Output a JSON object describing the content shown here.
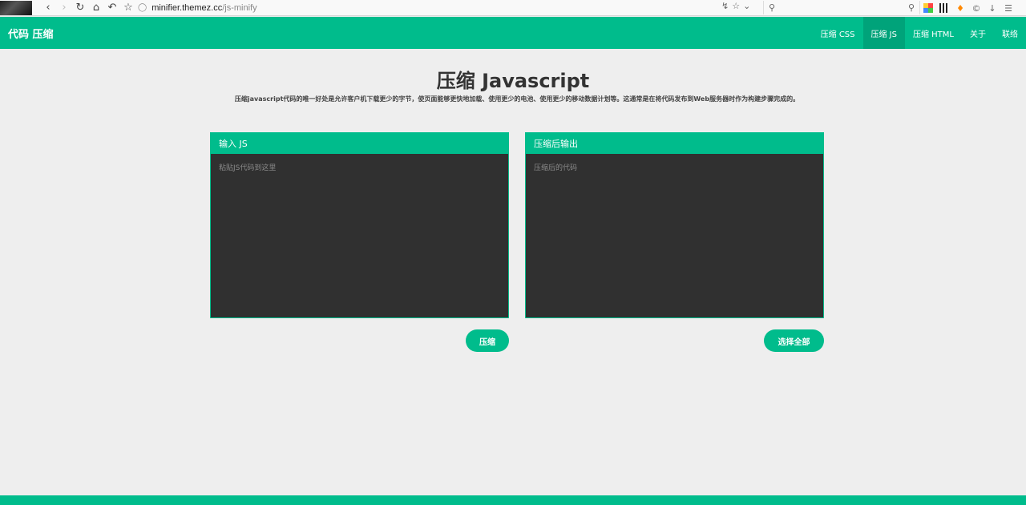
{
  "browser": {
    "url_host": "minifier.themez.cc",
    "url_path": "/js-minify"
  },
  "navbar": {
    "brand": "代码 压缩",
    "links": [
      {
        "label": "压缩 CSS",
        "active": false
      },
      {
        "label": "压缩 JS",
        "active": true
      },
      {
        "label": "压缩 HTML",
        "active": false
      },
      {
        "label": "关于",
        "active": false
      },
      {
        "label": "联络",
        "active": false
      }
    ]
  },
  "main": {
    "title_bold": "压缩",
    "title_rest": " Javascript",
    "description": "压缩javascript代码的唯一好处是允许客户机下载更少的字节，使页面能够更快地加载、使用更少的电池、使用更少的移动数据计划等。这通常是在将代码发布到Web服务器时作为构建步骤完成的。",
    "input_panel": {
      "header": "输入 JS",
      "placeholder": "粘贴JS代码到这里"
    },
    "output_panel": {
      "header": "压缩后输出",
      "placeholder": "压缩后的代码"
    },
    "compress_button": "压缩",
    "select_all_button": "选择全部"
  },
  "colors": {
    "accent": "#00bc8c",
    "accent_dark": "#00a37a",
    "panel_bg": "#303030",
    "page_bg": "#eeeeee"
  }
}
